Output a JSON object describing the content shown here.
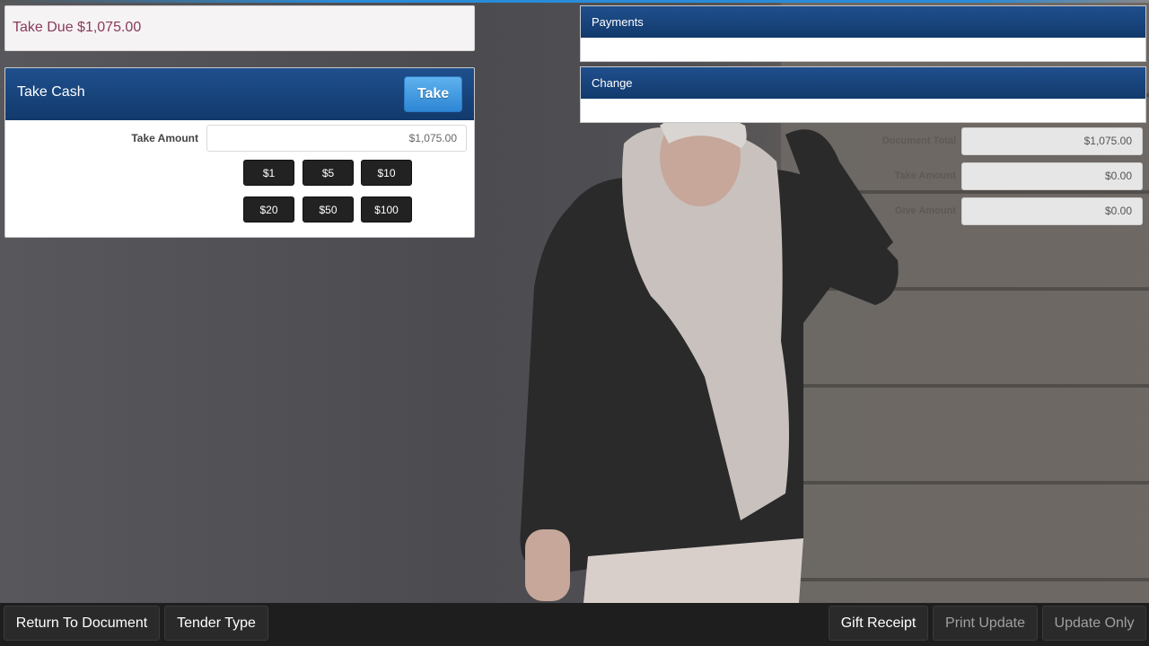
{
  "take_due": {
    "text": "Take Due $1,075.00"
  },
  "take_cash": {
    "title": "Take Cash",
    "take_label": "Take",
    "amount_label": "Take Amount",
    "amount_value": "$1,075.00",
    "denominations": [
      "$1",
      "$5",
      "$10",
      "$20",
      "$50",
      "$100"
    ]
  },
  "payments": {
    "title": "Payments"
  },
  "change": {
    "title": "Change"
  },
  "summary": {
    "rows": [
      {
        "label": "Document Total",
        "value": "$1,075.00"
      },
      {
        "label": "Take Amount",
        "value": "$0.00"
      },
      {
        "label": "Give Amount",
        "value": "$0.00"
      }
    ]
  },
  "bottom_bar": {
    "return_label": "Return To Document",
    "tender_label": "Tender Type",
    "gift_receipt_label": "Gift Receipt",
    "print_update_label": "Print Update",
    "update_only_label": "Update Only"
  },
  "colors": {
    "header_blue": "#1a4680",
    "take_button": "#2d86d4",
    "take_due_text": "#8a3a5c"
  }
}
